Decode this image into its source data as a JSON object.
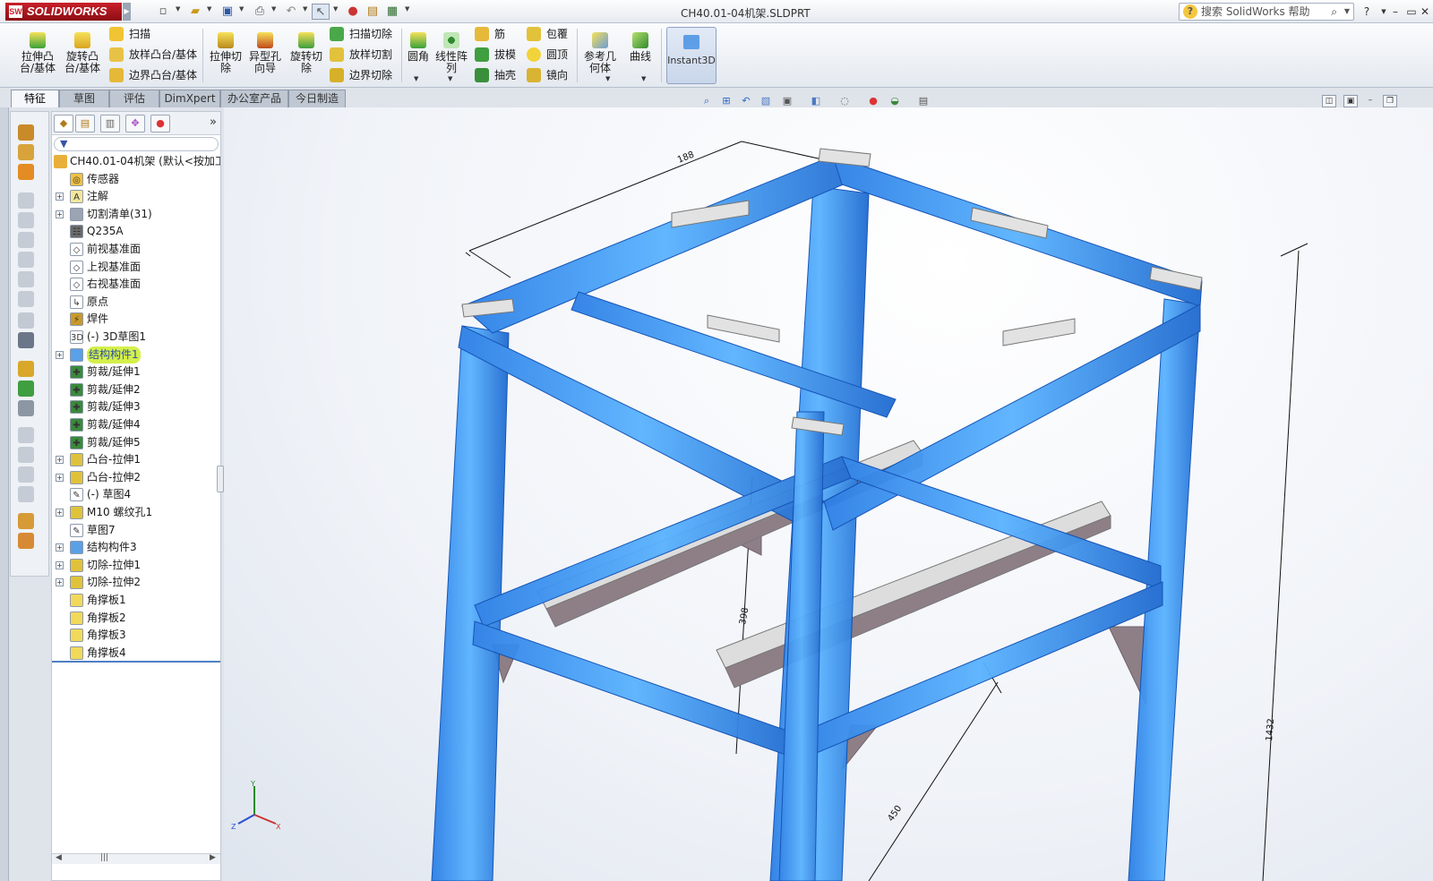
{
  "app": {
    "name": "SOLIDWORKS",
    "doc_title": "CH40.01-04机架.SLDPRT"
  },
  "help": {
    "search_placeholder": "搜索 SolidWorks 帮助"
  },
  "command_manager": {
    "big_buttons": [
      {
        "id": "extruded-boss",
        "label": "拉伸凸台/基体",
        "icon": "extrude-boss-icon"
      },
      {
        "id": "revolved-boss",
        "label": "旋转凸台/基体",
        "icon": "revolve-boss-icon"
      },
      {
        "id": "extruded-cut",
        "label": "拉伸切除",
        "icon": "extrude-cut-icon"
      },
      {
        "id": "hole-wizard",
        "label": "异型孔向导",
        "icon": "hole-wizard-icon"
      },
      {
        "id": "revolved-cut",
        "label": "旋转切除",
        "icon": "revolve-cut-icon"
      },
      {
        "id": "fillet",
        "label": "圆角",
        "icon": "fillet-icon"
      },
      {
        "id": "linear-pattern",
        "label": "线性阵列",
        "icon": "linear-pattern-icon"
      },
      {
        "id": "ref-geometry",
        "label": "参考几何体",
        "icon": "reference-geometry-icon"
      },
      {
        "id": "curves",
        "label": "曲线",
        "icon": "curves-icon"
      }
    ],
    "small_buttons": [
      {
        "id": "sweep",
        "label": "扫描"
      },
      {
        "id": "loft",
        "label": "放样凸台/基体"
      },
      {
        "id": "boundary-boss",
        "label": "边界凸台/基体"
      },
      {
        "id": "swept-cut",
        "label": "扫描切除"
      },
      {
        "id": "lofted-cut",
        "label": "放样切割"
      },
      {
        "id": "boundary-cut",
        "label": "边界切除"
      },
      {
        "id": "rib",
        "label": "筋"
      },
      {
        "id": "draft",
        "label": "拔模"
      },
      {
        "id": "shell",
        "label": "抽壳"
      },
      {
        "id": "wrap",
        "label": "包覆"
      },
      {
        "id": "dome",
        "label": "圆顶"
      },
      {
        "id": "mirror",
        "label": "镜向"
      }
    ],
    "instant3d": "Instant3D"
  },
  "tabs": [
    "特征",
    "草图",
    "评估",
    "DimXpert",
    "办公室产品",
    "今日制造"
  ],
  "active_tab": "特征",
  "feature_tree": {
    "filter_icon": "filter-icon",
    "root": "CH40.01-04机架  (默认<按加工",
    "items": [
      {
        "label": "传感器",
        "icon": "sensor-icon",
        "expandable": false
      },
      {
        "label": "注解",
        "icon": "annotation-icon",
        "expandable": true
      },
      {
        "label": "切割清单(31)",
        "icon": "cut-list-icon",
        "expandable": true
      },
      {
        "label": "Q235A",
        "icon": "material-icon",
        "expandable": false
      },
      {
        "label": "前视基准面",
        "icon": "plane-icon",
        "expandable": false
      },
      {
        "label": "上视基准面",
        "icon": "plane-icon",
        "expandable": false
      },
      {
        "label": "右视基准面",
        "icon": "plane-icon",
        "expandable": false
      },
      {
        "label": "原点",
        "icon": "origin-icon",
        "expandable": false
      },
      {
        "label": "焊件",
        "icon": "weldment-icon",
        "expandable": false
      },
      {
        "label": "(-) 3D草图1",
        "icon": "sketch3d-icon",
        "expandable": false
      },
      {
        "label": "结构构件1",
        "icon": "structural-member-icon",
        "expandable": true,
        "selected": true
      },
      {
        "label": "剪裁/延伸1",
        "icon": "trim-extend-icon",
        "expandable": false
      },
      {
        "label": "剪裁/延伸2",
        "icon": "trim-extend-icon",
        "expandable": false
      },
      {
        "label": "剪裁/延伸3",
        "icon": "trim-extend-icon",
        "expandable": false
      },
      {
        "label": "剪裁/延伸4",
        "icon": "trim-extend-icon",
        "expandable": false
      },
      {
        "label": "剪裁/延伸5",
        "icon": "trim-extend-icon",
        "expandable": false
      },
      {
        "label": "凸台-拉伸1",
        "icon": "boss-extrude-icon",
        "expandable": true
      },
      {
        "label": "凸台-拉伸2",
        "icon": "boss-extrude-icon",
        "expandable": true
      },
      {
        "label": "(-) 草图4",
        "icon": "sketch-icon",
        "expandable": false
      },
      {
        "label": "M10 螺纹孔1",
        "icon": "hole-icon",
        "expandable": true
      },
      {
        "label": "草图7",
        "icon": "sketch-icon",
        "expandable": false
      },
      {
        "label": "结构构件3",
        "icon": "structural-member-icon",
        "expandable": true
      },
      {
        "label": "切除-拉伸1",
        "icon": "cut-extrude-icon",
        "expandable": true
      },
      {
        "label": "切除-拉伸2",
        "icon": "cut-extrude-icon",
        "expandable": true
      },
      {
        "label": "角撑板1",
        "icon": "gusset-icon",
        "expandable": false
      },
      {
        "label": "角撑板2",
        "icon": "gusset-icon",
        "expandable": false
      },
      {
        "label": "角撑板3",
        "icon": "gusset-icon",
        "expandable": false
      },
      {
        "label": "角撑板4",
        "icon": "gusset-icon",
        "expandable": false
      }
    ]
  },
  "dimensions": [
    "188",
    "398",
    "1432",
    "450"
  ],
  "triad": {
    "x": "X",
    "y": "Y",
    "z": "Z"
  },
  "colors": {
    "member_blue": "#3f9cf0",
    "member_dark": "#1f6ad0",
    "plate": "#d9d9d9",
    "gusset": "#8e7f86",
    "highlight": "#d4f04a"
  }
}
